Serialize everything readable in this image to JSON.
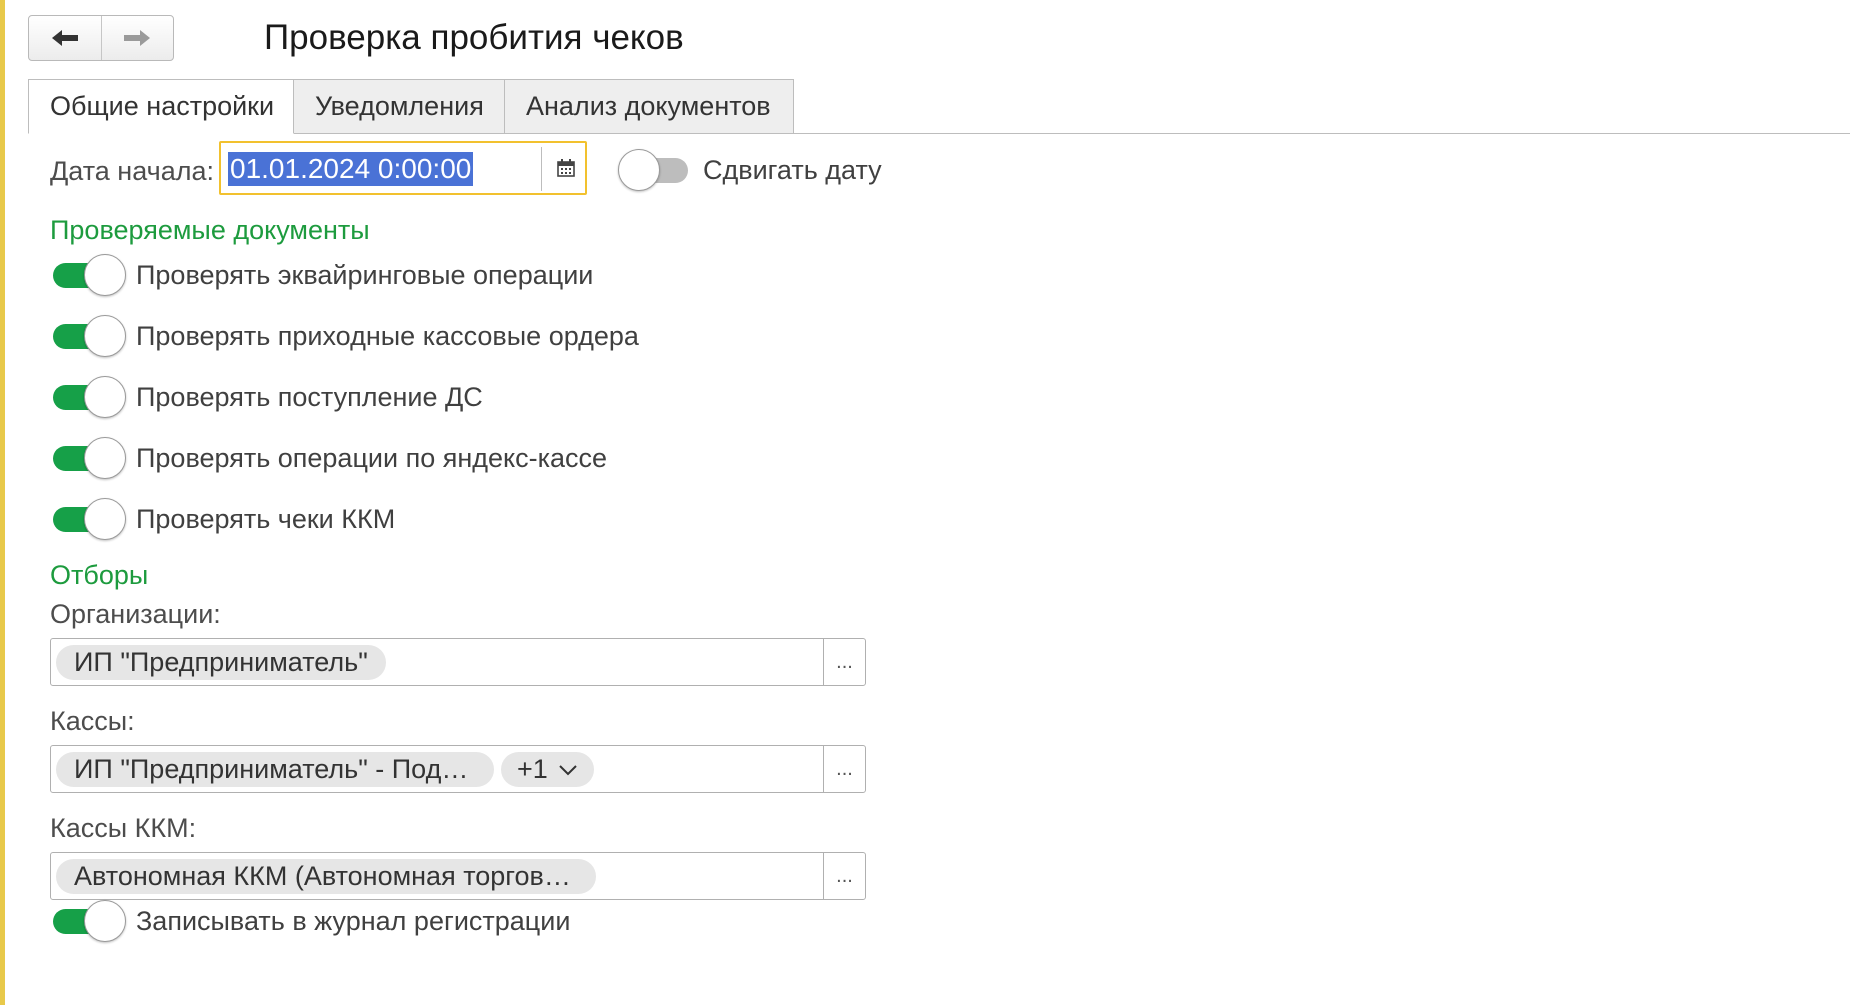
{
  "window": {
    "title": "Проверка пробития чеков"
  },
  "tabs": [
    {
      "label": "Общие настройки",
      "active": true
    },
    {
      "label": "Уведомления",
      "active": false
    },
    {
      "label": "Анализ документов",
      "active": false
    }
  ],
  "start_date": {
    "label": "Дата начала:",
    "value": "01.01.2024  0:00:00",
    "shift_toggle": {
      "label": "Сдвигать дату",
      "on": false
    }
  },
  "checked_documents": {
    "title": "Проверяемые документы",
    "items": [
      {
        "label": "Проверять эквайринговые операции",
        "on": true
      },
      {
        "label": "Проверять приходные кассовые ордера",
        "on": true
      },
      {
        "label": "Проверять поступление ДС",
        "on": true
      },
      {
        "label": "Проверять операции по яндекс-кассе",
        "on": true
      },
      {
        "label": "Проверять чеки ККМ",
        "on": true
      }
    ]
  },
  "filters": {
    "title": "Отборы",
    "organizations": {
      "label": "Организации:",
      "chips": [
        "ИП \"Предприниматель\""
      ],
      "more_button": "..."
    },
    "cash_desks": {
      "label": "Кассы:",
      "chips": [
        "ИП \"Предприниматель\" - Под…"
      ],
      "extra": "+1",
      "more_button": "..."
    },
    "kkm": {
      "label": "Кассы ККМ:",
      "chips": [
        "Автономная ККМ (Автономная торгов…"
      ],
      "more_button": "..."
    }
  },
  "log_toggle": {
    "label": "Записывать в журнал регистрации",
    "on": true
  },
  "colors": {
    "accent_green": "#1d9b3e",
    "toggle_on": "#16a048",
    "focus_border": "#f2c12e",
    "selection": "#4a72d6"
  },
  "icons": {
    "back": "arrow-left-icon",
    "forward": "arrow-right-icon",
    "calendar": "calendar-icon",
    "expand": "chevron-down-icon"
  }
}
